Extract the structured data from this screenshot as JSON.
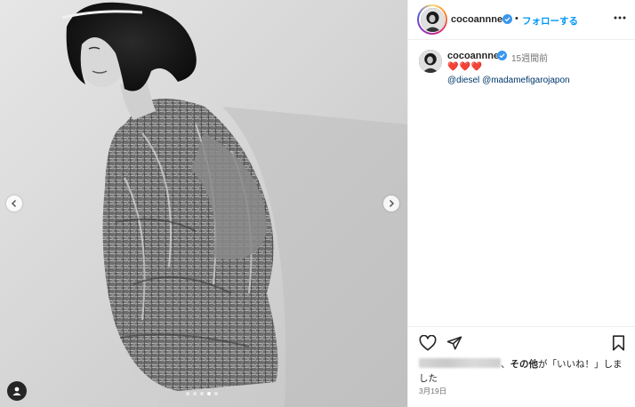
{
  "post": {
    "header": {
      "username": "cocoannne",
      "separator": "•",
      "follow_label": "フォローする"
    },
    "caption": {
      "username": "cocoannne",
      "time_ago": "15週間前",
      "emoji": "❤️❤️❤️",
      "mention_1": "@diesel",
      "mention_2": "@madamefigarojapon"
    },
    "likes": {
      "suffix_prefix": "、",
      "others_label": "その他",
      "suffix": "が「いいね！」しました"
    },
    "date": "3月19日"
  },
  "carousel": {
    "total": 5,
    "active_index": 3
  },
  "icons": {
    "verified": "verified-badge-icon",
    "more": "more-options-icon",
    "like": "heart-outline-icon",
    "share": "paper-plane-icon",
    "save": "bookmark-outline-icon",
    "prev": "chevron-left-icon",
    "next": "chevron-right-icon",
    "tags": "user-tag-icon"
  },
  "colors": {
    "accent": "#0095f6",
    "verified": "#3897f0",
    "mention": "#00376b",
    "heart": "#e0245e"
  }
}
